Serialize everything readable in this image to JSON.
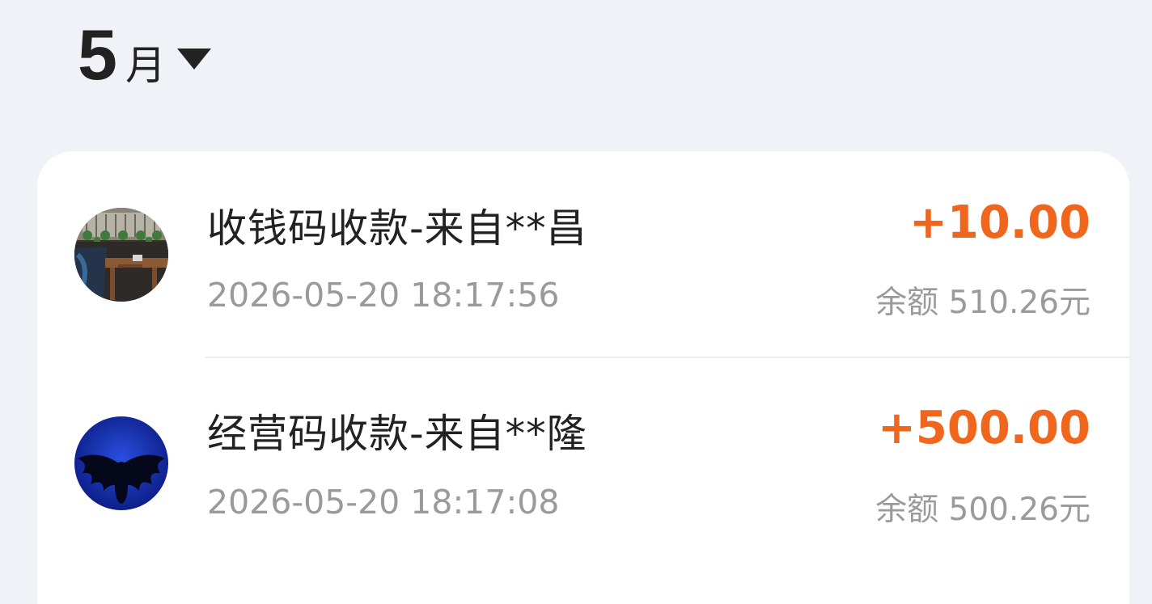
{
  "header": {
    "month_number": "5",
    "month_unit": "月"
  },
  "transactions": [
    {
      "title": "收钱码收款-来自**昌",
      "time": "2026-05-20 18:17:56",
      "amount": "+10.00",
      "balance": "余额 510.26元",
      "avatar": "restaurant-photo-avatar"
    },
    {
      "title": "经营码收款-来自**隆",
      "time": "2026-05-20 18:17:08",
      "amount": "+500.00",
      "balance": "余额 500.26元",
      "avatar": "winged-figure-avatar"
    }
  ],
  "colors": {
    "background": "#f0f2f7",
    "card": "#ffffff",
    "amount": "#f0661c",
    "primary_text": "#222222",
    "secondary_text": "#9a9a9a"
  }
}
